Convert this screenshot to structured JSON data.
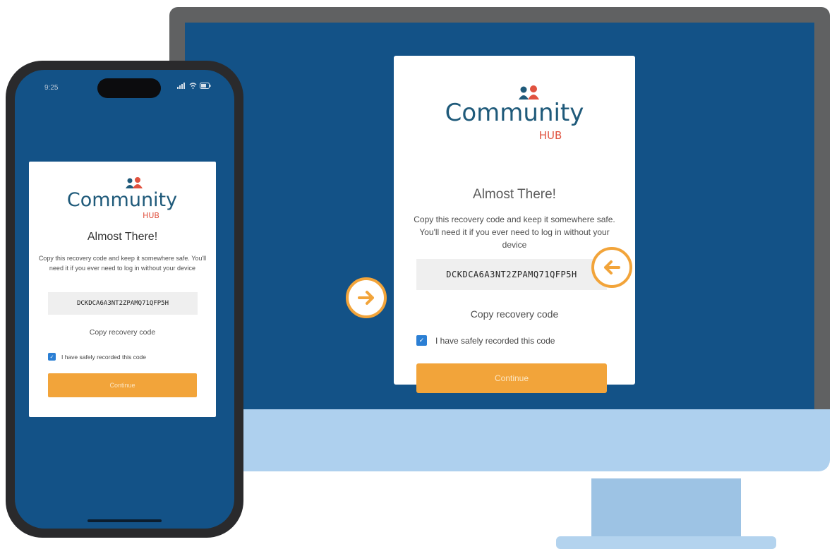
{
  "brand": {
    "name_main": "Community",
    "name_sub": "HUB",
    "colors": {
      "navy": "#135287",
      "accent": "#f2a43a",
      "logo_teal": "#1f5a7a",
      "logo_red": "#e0523f",
      "checkbox": "#2b7fd4"
    }
  },
  "desktop": {
    "title": "Almost There!",
    "description": "Copy this recovery code and keep it somewhere safe. You'll need it if you ever need to log in without your device",
    "recovery_code": "DCKDCA6A3NT2ZPAMQ71QFP5H",
    "copy_label": "Copy recovery code",
    "checkbox_label": "I have safely recorded this code",
    "checkbox_checked": true,
    "continue_label": "Continue",
    "arrow_left_badge_icon": "arrow-right-icon",
    "arrow_right_badge_icon": "arrow-left-icon"
  },
  "phone": {
    "status_time": "9:25",
    "status_icons": "signal wifi battery",
    "title": "Almost There!",
    "description": "Copy this recovery code and keep it somewhere safe. You'll need it if you ever need to log in without your device",
    "recovery_code": "DCKDCA6A3NT2ZPAMQ71QFP5H",
    "copy_label": "Copy recovery code",
    "checkbox_label": "I have safely recorded this code",
    "checkbox_checked": true,
    "continue_label": "Continue"
  }
}
